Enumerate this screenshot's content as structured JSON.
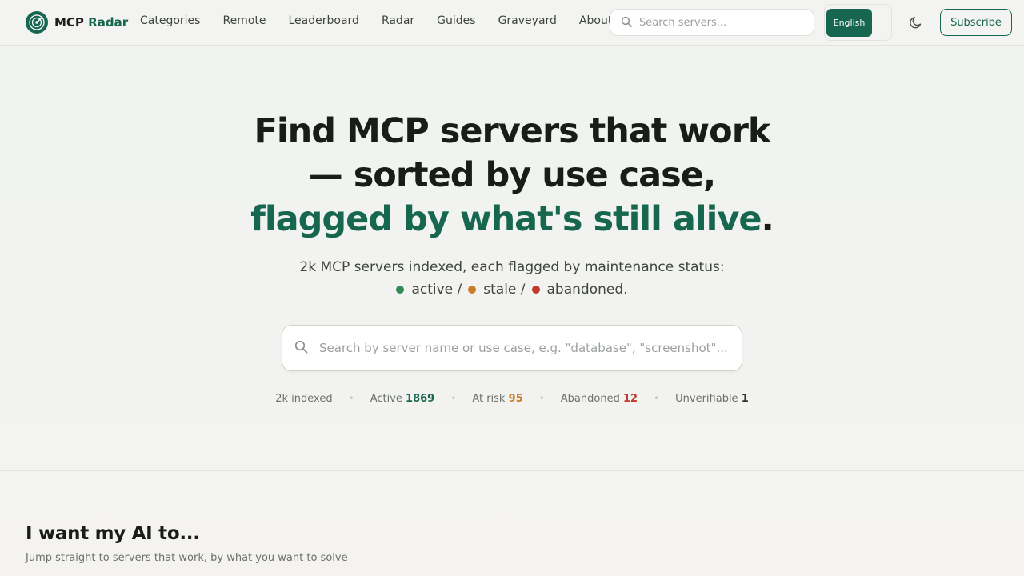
{
  "nav": {
    "brand_primary": "MCP",
    "brand_accent": "Radar",
    "links": [
      "Categories",
      "Remote",
      "Leaderboard",
      "Radar",
      "Guides",
      "Graveyard",
      "About"
    ],
    "search_placeholder": "Search servers...",
    "language_label": "English",
    "subscribe_label": "Subscribe",
    "theme_icon": "moon-icon"
  },
  "hero": {
    "title_part1": "Find MCP servers that work — sorted by use case, ",
    "title_highlight": "flagged by what's still alive",
    "title_end": ".",
    "subtitle": "2k MCP servers indexed, each flagged by maintenance status:",
    "status_active": "active /",
    "status_stale": "stale /",
    "status_abandoned": "abandoned."
  },
  "search": {
    "placeholder": "Search by server name or use case, e.g. \"database\", \"screenshot\"..."
  },
  "stats": {
    "indexed_label": "2k indexed",
    "active_label": "Active",
    "active_value": "1869",
    "at_risk_label": "At risk",
    "at_risk_value": "95",
    "abandoned_label": "Abandoned",
    "abandoned_value": "12",
    "unverifiable_label": "Unverifiable",
    "unverifiable_value": "1"
  },
  "section": {
    "title": "I want my AI to...",
    "subtitle": "Jump straight to servers that work, by what you want to solve"
  },
  "colors": {
    "brand": "#17664f",
    "active": "#2e8b57",
    "at_risk": "#c97b2a",
    "abandoned": "#c0392b",
    "background": "#f1f3ef"
  }
}
